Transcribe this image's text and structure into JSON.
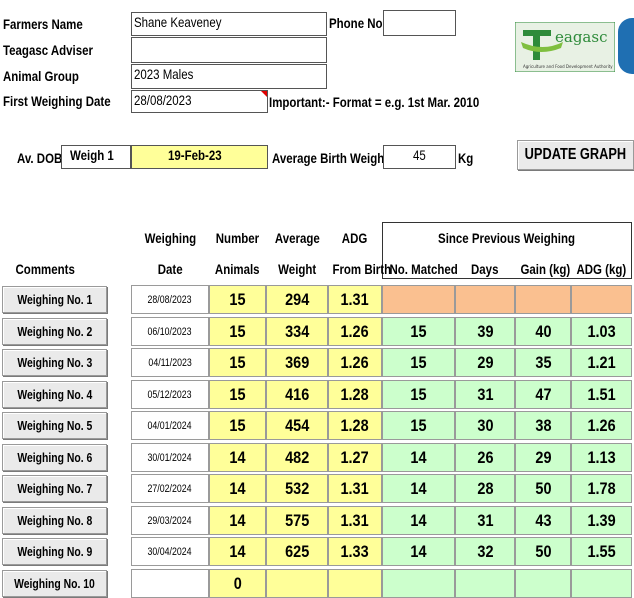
{
  "header_form": {
    "farmers_name_label": "Farmers Name",
    "farmers_name_value": "Shane Keaveney",
    "phone_label": "Phone No.",
    "phone_value": "",
    "adviser_label": "Teagasc Adviser",
    "adviser_value": "",
    "animal_group_label": "Animal Group",
    "animal_group_value": "2023 Males",
    "first_weighing_label": "First Weighing Date",
    "first_weighing_value": "28/08/2023",
    "format_note": "Important:- Format = e.g. 1st Mar. 2010"
  },
  "summary_row": {
    "av_dob_label": "Av. DOB",
    "weigh_label": "Weigh 1",
    "dob_value": "19-Feb-23",
    "avg_birth_weight_label": "Average Birth Weight",
    "avg_birth_weight_value": "45",
    "unit": "Kg"
  },
  "update_button": "UPDATE GRAPH",
  "logo": {
    "text": "eagasc",
    "tagline": "Agriculture and Food Development Authority",
    "colors": {
      "green": "#2e8b3a",
      "blue": "#1f6fb2"
    }
  },
  "table": {
    "headers": {
      "weighing": "Weighing",
      "date": "Date",
      "number": "Number",
      "animals": "Animals",
      "average": "Average",
      "weight": "Weight",
      "adg": "ADG",
      "from_birth": "From Birth",
      "since_prev": "Since Previous Weighing",
      "no_matched": "No. Matched",
      "days": "Days",
      "gain": "Gain (kg)",
      "adg_kg": "ADG (kg)",
      "comments": "Comments"
    },
    "rows": [
      {
        "button": "Weighing No. 1",
        "date": "28/08/2023",
        "number": "15",
        "weight": "294",
        "adg": "1.31",
        "matched": "",
        "days": "",
        "gain": "",
        "adg_prev": ""
      },
      {
        "button": "Weighing No. 2",
        "date": "06/10/2023",
        "number": "15",
        "weight": "334",
        "adg": "1.26",
        "matched": "15",
        "days": "39",
        "gain": "40",
        "adg_prev": "1.03"
      },
      {
        "button": "Weighing No. 3",
        "date": "04/11/2023",
        "number": "15",
        "weight": "369",
        "adg": "1.26",
        "matched": "15",
        "days": "29",
        "gain": "35",
        "adg_prev": "1.21"
      },
      {
        "button": "Weighing No. 4",
        "date": "05/12/2023",
        "number": "15",
        "weight": "416",
        "adg": "1.28",
        "matched": "15",
        "days": "31",
        "gain": "47",
        "adg_prev": "1.51"
      },
      {
        "button": "Weighing No. 5",
        "date": "04/01/2024",
        "number": "15",
        "weight": "454",
        "adg": "1.28",
        "matched": "15",
        "days": "30",
        "gain": "38",
        "adg_prev": "1.26"
      },
      {
        "button": "Weighing No. 6",
        "date": "30/01/2024",
        "number": "14",
        "weight": "482",
        "adg": "1.27",
        "matched": "14",
        "days": "26",
        "gain": "29",
        "adg_prev": "1.13"
      },
      {
        "button": "Weighing No. 7",
        "date": "27/02/2024",
        "number": "14",
        "weight": "532",
        "adg": "1.31",
        "matched": "14",
        "days": "28",
        "gain": "50",
        "adg_prev": "1.78"
      },
      {
        "button": "Weighing No. 8",
        "date": "29/03/2024",
        "number": "14",
        "weight": "575",
        "adg": "1.31",
        "matched": "14",
        "days": "31",
        "gain": "43",
        "adg_prev": "1.39"
      },
      {
        "button": "Weighing No. 9",
        "date": "30/04/2024",
        "number": "14",
        "weight": "625",
        "adg": "1.33",
        "matched": "14",
        "days": "32",
        "gain": "50",
        "adg_prev": "1.55"
      },
      {
        "button": "Weighing No. 10",
        "date": "",
        "number": "0",
        "weight": "",
        "adg": "",
        "matched": "",
        "days": "",
        "gain": "",
        "adg_prev": ""
      }
    ]
  }
}
